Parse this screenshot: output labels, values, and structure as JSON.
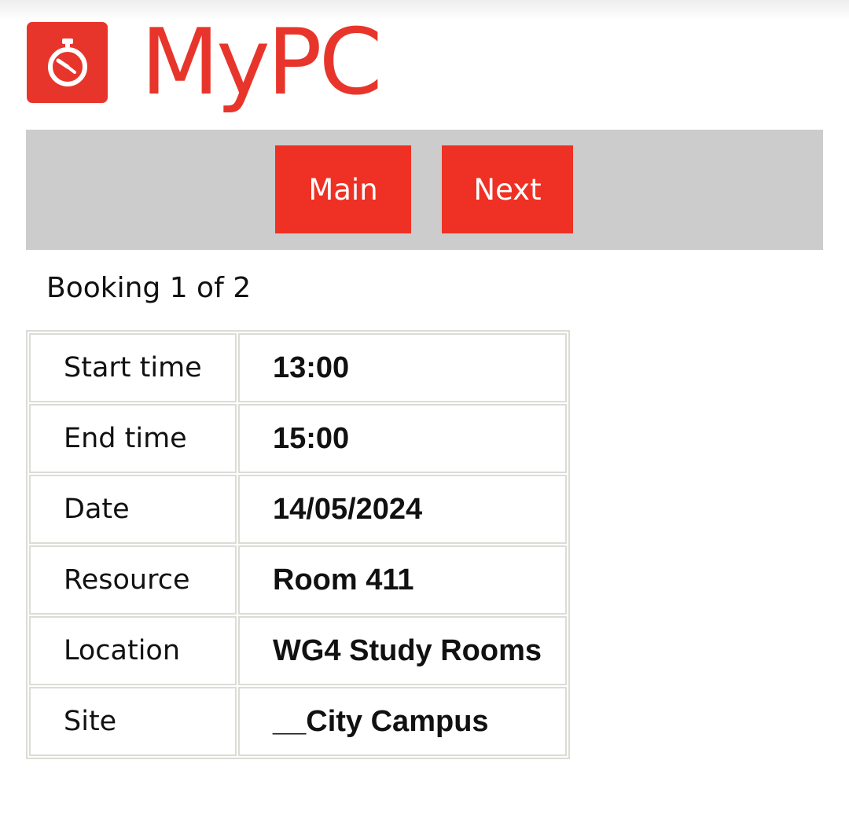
{
  "header": {
    "logo_icon": "stopwatch-icon",
    "logo_text": "MyPC"
  },
  "nav": {
    "main_label": "Main",
    "next_label": "Next"
  },
  "booking": {
    "count_text": "Booking 1 of 2",
    "rows": [
      {
        "label": "Start time",
        "value": "13:00"
      },
      {
        "label": "End time",
        "value": "15:00"
      },
      {
        "label": "Date",
        "value": "14/05/2024"
      },
      {
        "label": "Resource",
        "value": "Room 411"
      },
      {
        "label": "Location",
        "value": "WG4 Study Rooms"
      },
      {
        "label": "Site",
        "value": "__City Campus"
      }
    ]
  },
  "colors": {
    "brand_red": "#e8352b",
    "button_red": "#ee3124",
    "nav_bar_grey": "#cccccc",
    "table_border": "#dcdcd6"
  }
}
